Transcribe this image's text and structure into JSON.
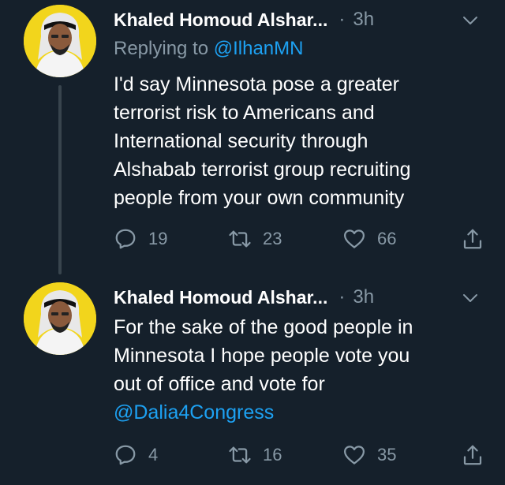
{
  "tweets": [
    {
      "author_name": "Khaled Homoud Alshar...",
      "separator": "·",
      "time": "3h",
      "replying_label": "Replying to",
      "replying_handle": "@IlhanMN",
      "text_lines": [
        "I'd say Minnesota pose a greater",
        "terrorist risk to Americans and",
        "International security through",
        "Alshabab terrorist group recruiting",
        "people from your own community"
      ],
      "replies": "19",
      "retweets": "23",
      "likes": "66"
    },
    {
      "author_name": "Khaled Homoud Alshar...",
      "separator": "·",
      "time": "3h",
      "text_lines": [
        "For the sake of the good people in",
        "Minnesota I hope people vote you",
        "out of office and vote for"
      ],
      "mention": "@Dalia4Congress",
      "replies": "4",
      "retweets": "16",
      "likes": "35"
    }
  ],
  "icons": {
    "reply": "reply-icon",
    "retweet": "retweet-icon",
    "like": "heart-icon",
    "share": "share-icon",
    "menu": "chevron-down-icon"
  },
  "colors": {
    "background": "#15202b",
    "secondary_text": "#8899a6",
    "link": "#1da1f2",
    "avatar_bg": "#f2d51c"
  }
}
